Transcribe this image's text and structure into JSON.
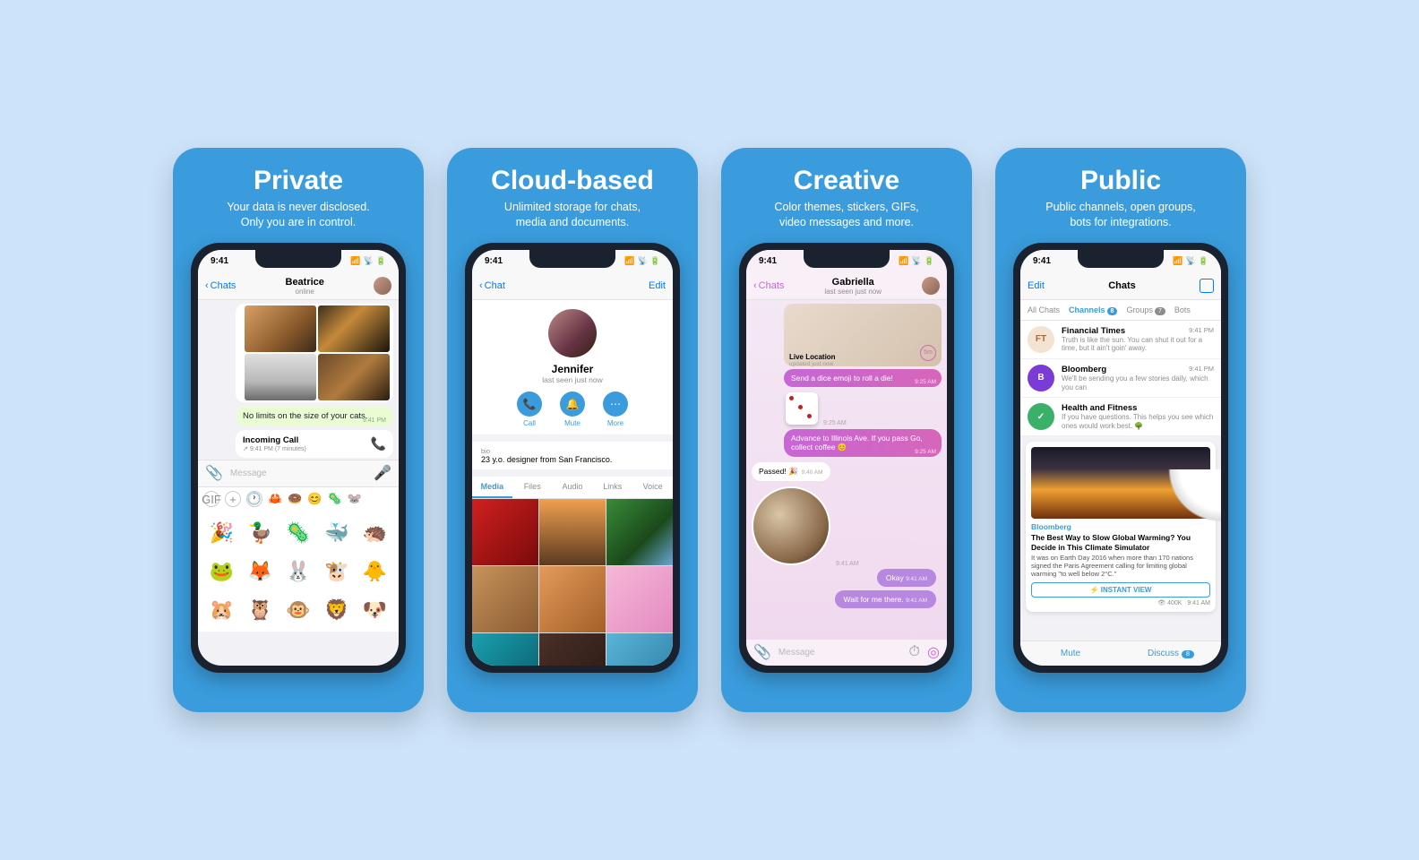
{
  "status_time": "9:41",
  "cards": [
    {
      "title": "Private",
      "subtitle1": "Your data is never disclosed.",
      "subtitle2": "Only you are in control.",
      "nav_back": "Chats",
      "contact_name": "Beatrice",
      "contact_status": "online",
      "message1": "No limits on the size of your cats.",
      "message1_time": "9:41 PM",
      "call_label": "Incoming Call",
      "call_meta": "9:41 PM (7 minutes)",
      "input_placeholder": "Message"
    },
    {
      "title": "Cloud-based",
      "subtitle1": "Unlimited storage for chats,",
      "subtitle2": "media and documents.",
      "nav_back": "Chat",
      "nav_edit": "Edit",
      "name": "Jennifer",
      "seen": "last seen just now",
      "action_call": "Call",
      "action_mute": "Mute",
      "action_more": "More",
      "bio_label": "bio",
      "bio_text": "23 y.o. designer from San Francisco.",
      "tabs": [
        "Media",
        "Files",
        "Audio",
        "Links",
        "Voice"
      ]
    },
    {
      "title": "Creative",
      "subtitle1": "Color themes, stickers, GIFs,",
      "subtitle2": "video messages and more.",
      "nav_back": "Chats",
      "contact_name": "Gabriella",
      "contact_status": "last seen just now",
      "live_location": "Live Location",
      "live_updated": "updated just now",
      "live_badge": "5m",
      "msg_dice": "Send a dice emoji to roll a die!",
      "dice_time": "9:25 AM",
      "after_dice_time": "9:25 AM",
      "msg_advance": "Advance to Illinois Ave. If you pass Go, collect coffee 😊",
      "advance_time": "9:25 AM",
      "msg_passed": "Passed! 🎉",
      "passed_time": "9:40 AM",
      "video_time": "9:41 AM",
      "msg_okay": "Okay",
      "okay_time": "9:41 AM",
      "msg_wait": "Wait for me there.",
      "wait_time": "9:41 AM",
      "input_placeholder": "Message"
    },
    {
      "title": "Public",
      "subtitle1": "Public channels, open groups,",
      "subtitle2": "bots for integrations.",
      "nav_edit": "Edit",
      "nav_title": "Chats",
      "filters": {
        "all": "All Chats",
        "channels": "Channels",
        "channels_badge": "8",
        "groups": "Groups",
        "groups_badge": "7",
        "bots": "Bots"
      },
      "rows": [
        {
          "av": "FT",
          "name": "Financial Times",
          "time": "9:41 PM",
          "msg": "Truth is like the sun. You can shut it out for a time, but it ain't goin' away."
        },
        {
          "av": "B",
          "name": "Bloomberg",
          "time": "9:41 PM",
          "msg": "We'll be sending you a few stories daily, which you can"
        },
        {
          "av": "✓",
          "name": "Health and Fitness",
          "time": "",
          "msg": "If you have questions. This helps you see which ones would work best. 🌳"
        }
      ],
      "article": {
        "source": "Bloomberg",
        "headline": "The Best Way to Slow Global Warming? You Decide in This Climate Simulator",
        "desc": "It was on Earth Day 2016 when more than 170 nations signed the Paris Agreement calling for limiting global warming \"to well below 2°C.\"",
        "instant_view": "⚡ INSTANT VIEW",
        "views": "400K",
        "time": "9:41 AM"
      },
      "bottom_mute": "Mute",
      "bottom_discuss": "Discuss",
      "bottom_discuss_badge": "8"
    }
  ]
}
